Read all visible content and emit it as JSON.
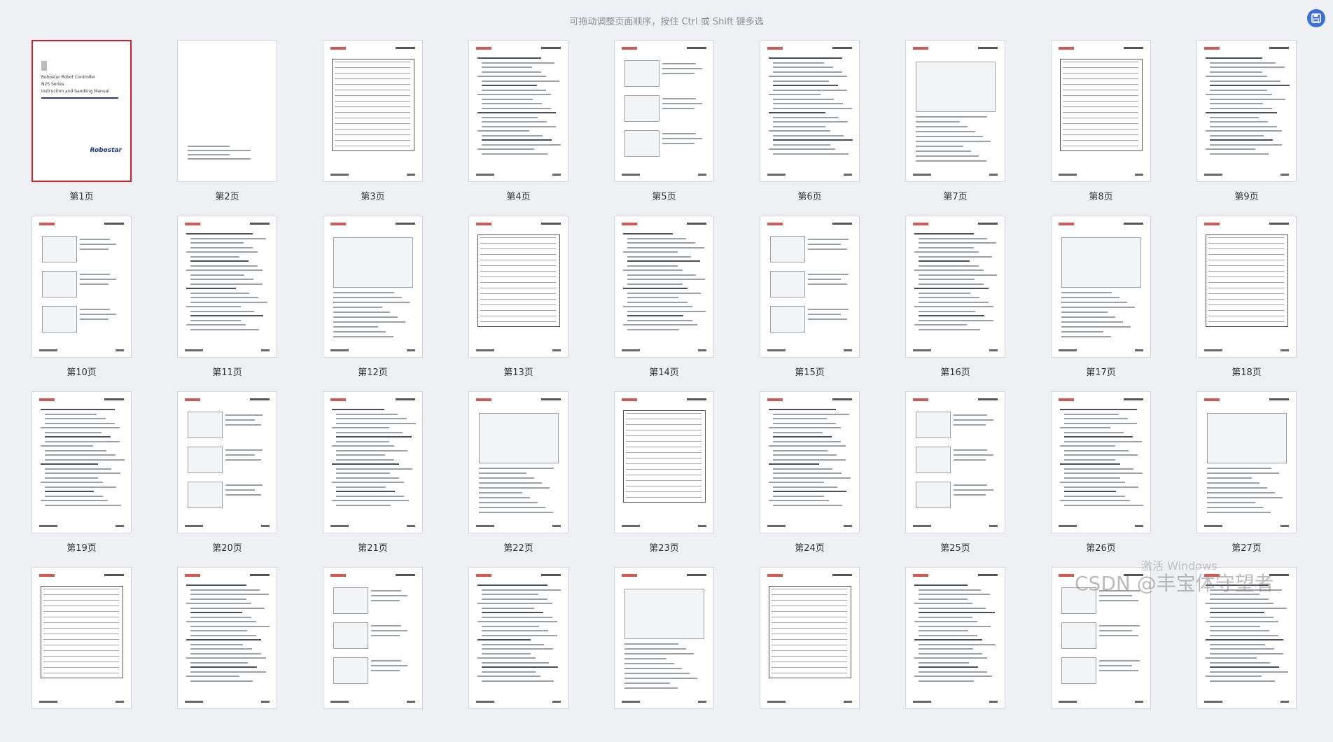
{
  "hint": "可拖动调整页面顺序，按住 Ctrl 或 Shift 键多选",
  "toolbar": {
    "save_icon": "save-icon"
  },
  "cover": {
    "line1": "Robostar Robot Controller",
    "line2": "N2S Series",
    "line3": "Instruction and handling Manual",
    "logo": "Robostar"
  },
  "pages": [
    {
      "label": "第1页"
    },
    {
      "label": "第2页"
    },
    {
      "label": "第3页"
    },
    {
      "label": "第4页"
    },
    {
      "label": "第5页"
    },
    {
      "label": "第6页"
    },
    {
      "label": "第7页"
    },
    {
      "label": "第8页"
    },
    {
      "label": "第9页"
    },
    {
      "label": "第10页"
    },
    {
      "label": "第11页"
    },
    {
      "label": "第12页"
    },
    {
      "label": "第13页"
    },
    {
      "label": "第14页"
    },
    {
      "label": "第15页"
    },
    {
      "label": "第16页"
    },
    {
      "label": "第17页"
    },
    {
      "label": "第18页"
    },
    {
      "label": "第19页"
    },
    {
      "label": "第20页"
    },
    {
      "label": "第21页"
    },
    {
      "label": "第22页"
    },
    {
      "label": "第23页"
    },
    {
      "label": "第24页"
    },
    {
      "label": "第25页"
    },
    {
      "label": "第26页"
    },
    {
      "label": "第27页"
    },
    {
      "label": ""
    },
    {
      "label": ""
    },
    {
      "label": ""
    },
    {
      "label": ""
    },
    {
      "label": ""
    },
    {
      "label": ""
    },
    {
      "label": ""
    },
    {
      "label": ""
    },
    {
      "label": ""
    }
  ],
  "selected_page": 1,
  "watermark": {
    "line1": "激活 Windows",
    "line2": "CSDN @丰宝体守望者"
  },
  "colors": {
    "accent": "#3b6fd6",
    "selection": "#d11f26",
    "brand": "#2a3990"
  }
}
